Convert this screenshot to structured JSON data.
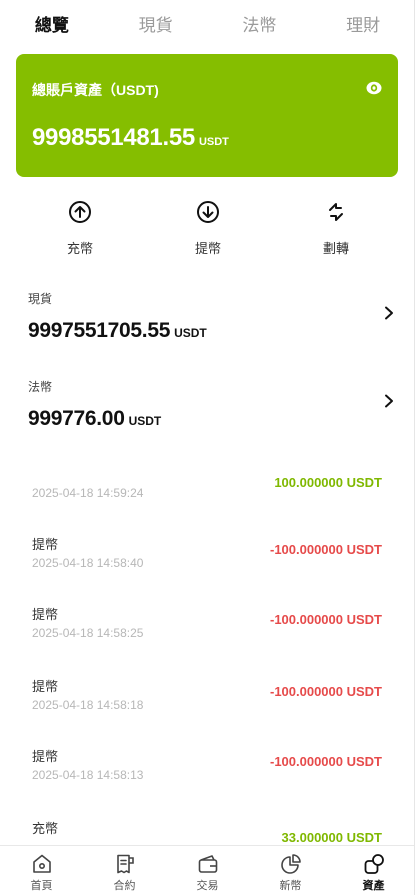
{
  "tabs": [
    {
      "label": "總覽",
      "active": true
    },
    {
      "label": "現貨",
      "active": false
    },
    {
      "label": "法幣",
      "active": false
    },
    {
      "label": "理財",
      "active": false
    }
  ],
  "account_card": {
    "title": "總賬戶資產（USDT)",
    "amount": "9998551481.55",
    "unit": "USDT",
    "background_color": "#85be00"
  },
  "actions": [
    {
      "label": "充幣",
      "icon": "arrow-up-circle-icon"
    },
    {
      "label": "提幣",
      "icon": "arrow-down-circle-icon"
    },
    {
      "label": "劃轉",
      "icon": "transfer-arrows-icon"
    }
  ],
  "spot": {
    "title": "現貨",
    "amount": "9997551705.55",
    "unit": "USDT"
  },
  "fiat": {
    "title": "法幣",
    "amount": "999776.00",
    "unit": "USDT"
  },
  "records": [
    {
      "type": "",
      "time": "2025-04-18 14:59:24",
      "amount": "100.000000 USDT",
      "direction": "positive"
    },
    {
      "type": "提幣",
      "time": "2025-04-18 14:58:40",
      "amount": "-100.000000 USDT",
      "direction": "negative"
    },
    {
      "type": "提幣",
      "time": "2025-04-18 14:58:25",
      "amount": "-100.000000 USDT",
      "direction": "negative"
    },
    {
      "type": "提幣",
      "time": "2025-04-18 14:58:18",
      "amount": "-100.000000 USDT",
      "direction": "negative"
    },
    {
      "type": "提幣",
      "time": "2025-04-18 14:58:13",
      "amount": "-100.000000 USDT",
      "direction": "negative"
    },
    {
      "type": "充幣",
      "time": "",
      "amount": "33.000000 USDT",
      "direction": "positive"
    }
  ],
  "bottom_nav": [
    {
      "label": "首頁",
      "icon": "home-icon",
      "active": false
    },
    {
      "label": "合約",
      "icon": "contract-icon",
      "active": false
    },
    {
      "label": "交易",
      "icon": "wallet-icon",
      "active": false
    },
    {
      "label": "新幣",
      "icon": "pie-chart-icon",
      "active": false
    },
    {
      "label": "資產",
      "icon": "assets-icon",
      "active": true
    }
  ],
  "colors": {
    "accent": "#85be00",
    "positive": "#7fb800",
    "negative": "#e64a4a"
  }
}
